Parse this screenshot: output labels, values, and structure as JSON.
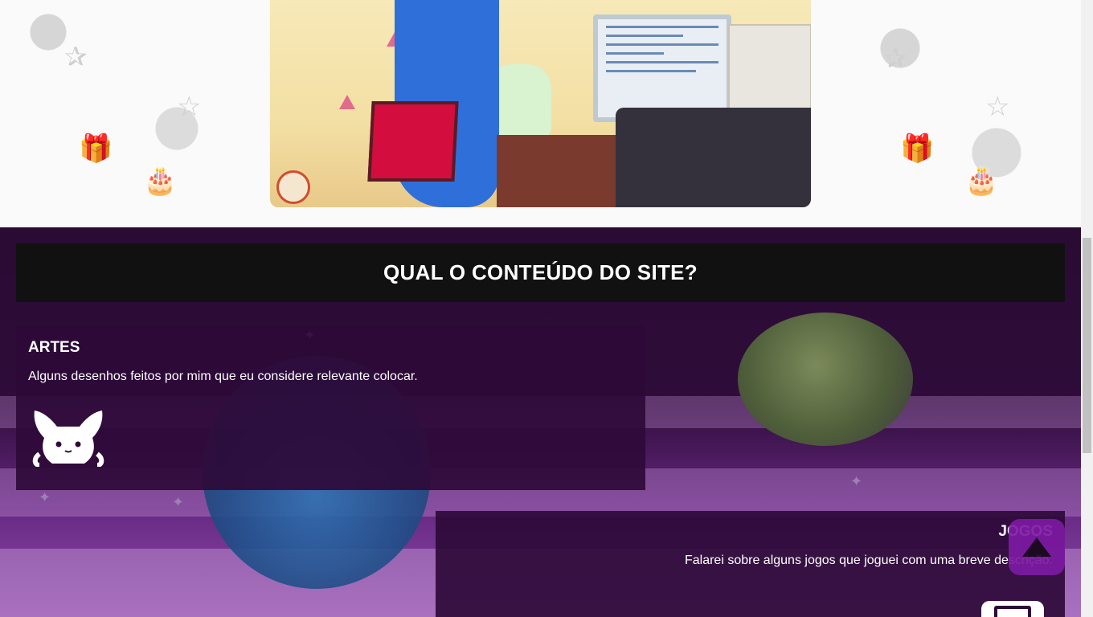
{
  "hero": {
    "image_icon": "anime-girl-at-computer-gif"
  },
  "section": {
    "title": "QUAL O CONTEÚDO DO SITE?"
  },
  "cards": {
    "artes": {
      "title": "ARTES",
      "description": "Alguns desenhos feitos por mim que eu considere relevante colocar.",
      "icon": "pikachu-icon"
    },
    "jogos": {
      "title": "JOGOS",
      "description": "Falarei sobre alguns jogos que joguei com uma breve descrição.",
      "icon": "gameboy-icon"
    }
  },
  "scroll_top": {
    "icon": "arrow-up-icon",
    "color": "#7d1aa3"
  },
  "colors": {
    "heading_bar": "#111111",
    "card_bg": "#2e0a38",
    "space_top": "#2a0b33",
    "space_bottom": "#8d4ba8"
  }
}
